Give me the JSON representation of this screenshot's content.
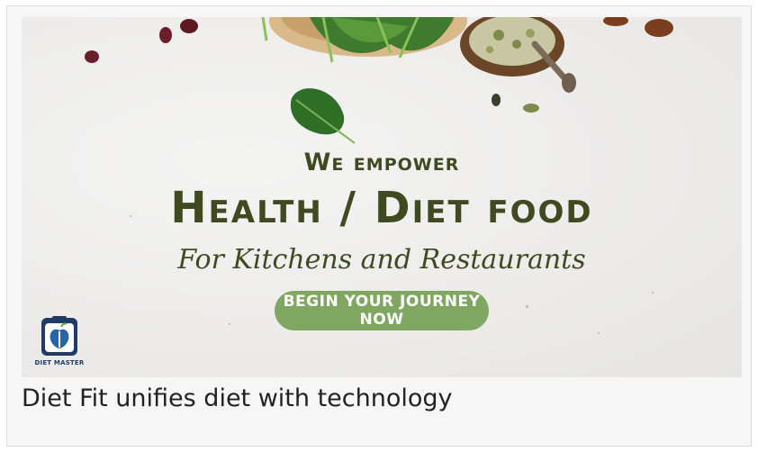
{
  "banner": {
    "line1": "We empower",
    "line2": "Health / Diet food",
    "line3": "For Kitchens  and Restaurants",
    "cta_label": "BEGIN YOUR JOURNEY NOW",
    "logo_text": "DIET MASTER"
  },
  "caption": "Diet Fit unifies diet with technology",
  "colors": {
    "headline": "#3f4a21",
    "cta_background": "#7fa761",
    "cta_text": "#ffffff"
  }
}
